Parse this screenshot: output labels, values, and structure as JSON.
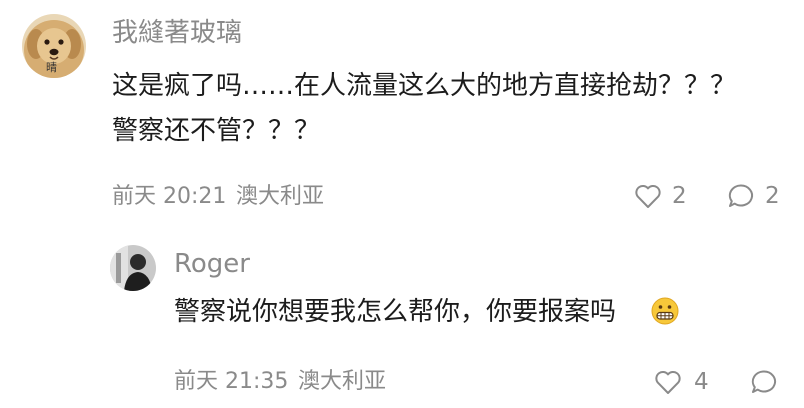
{
  "comments": [
    {
      "username": "我縫著玻璃",
      "avatar_icon": "dog-avatar-icon",
      "avatar_badge": "晴",
      "lines": [
        "这是疯了吗……在人流量这么大的地方直接抢劫？？？",
        "警察还不管？？？"
      ],
      "time": "前天 20:21",
      "location": "澳大利亚",
      "like_icon": "heart-outline-icon",
      "like_count": "2",
      "reply_icon": "comment-bubble-icon",
      "reply_count": "2"
    },
    {
      "username": "Roger",
      "avatar_icon": "dark-portrait-avatar-icon",
      "text": "警察说你想要我怎么帮你，你要报案吗",
      "emoji_icon": "grimacing-face-emoji-icon",
      "time": "前天 21:35",
      "location": "澳大利亚",
      "like_icon": "heart-outline-icon",
      "like_count": "4",
      "reply_icon": "comment-bubble-icon"
    }
  ],
  "colors": {
    "text_primary": "#1c1c1c",
    "text_secondary": "#8a8a8a",
    "background": "#ffffff"
  }
}
